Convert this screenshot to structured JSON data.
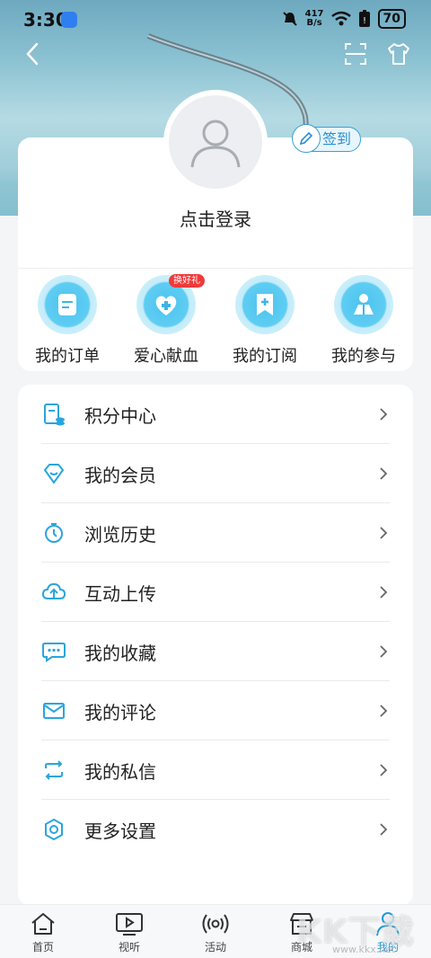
{
  "status_bar": {
    "time": "3:30",
    "net_speed_value": "417",
    "net_speed_unit": "B/s",
    "battery": "70"
  },
  "profile": {
    "signin_label": "签到",
    "login_prompt": "点击登录"
  },
  "quick_actions": [
    {
      "label": "我的订单",
      "icon": "order-icon"
    },
    {
      "label": "爱心献血",
      "icon": "blood-donation-icon",
      "badge": "换好礼"
    },
    {
      "label": "我的订阅",
      "icon": "subscription-icon"
    },
    {
      "label": "我的参与",
      "icon": "participation-icon"
    }
  ],
  "menu": [
    {
      "label": "积分中心",
      "icon": "points-icon"
    },
    {
      "label": "我的会员",
      "icon": "diamond-icon"
    },
    {
      "label": "浏览历史",
      "icon": "clock-icon"
    },
    {
      "label": "互动上传",
      "icon": "cloud-upload-icon"
    },
    {
      "label": "我的收藏",
      "icon": "chat-bubble-icon"
    },
    {
      "label": "我的评论",
      "icon": "mail-icon"
    },
    {
      "label": "我的私信",
      "icon": "sync-icon"
    },
    {
      "label": "更多设置",
      "icon": "settings-icon"
    }
  ],
  "tabs": [
    {
      "label": "首页",
      "icon": "home-icon"
    },
    {
      "label": "视听",
      "icon": "video-icon"
    },
    {
      "label": "活动",
      "icon": "broadcast-icon"
    },
    {
      "label": "商城",
      "icon": "store-icon"
    },
    {
      "label": "我的",
      "icon": "user-icon",
      "active": true
    }
  ],
  "watermark": {
    "main": "KK下载",
    "sub": "www.kkx.net"
  },
  "colors": {
    "accent": "#1e9ad8",
    "badge": "#ef3a3a"
  }
}
